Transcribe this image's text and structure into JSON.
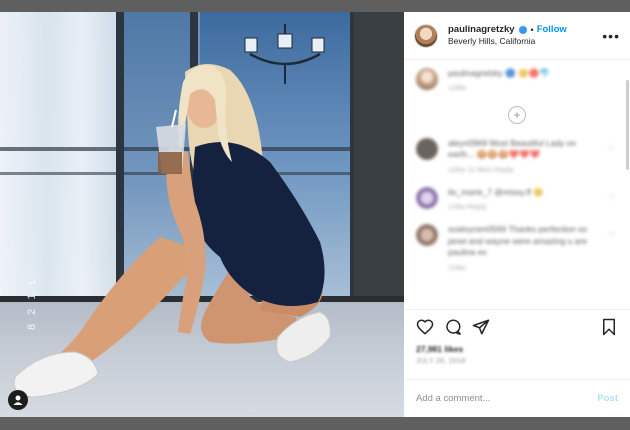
{
  "post": {
    "image_alt": "Woman with long blonde hair in a navy t-shirt and shorts crouching barefoot-style in white sneakers holding an iced drink on a balcony",
    "story_tag": "8 2 1 L"
  },
  "header": {
    "username": "paulinagretzky",
    "follow_label": "Follow",
    "dot": "•",
    "location": "Beverly Hills, California",
    "more_icon": "•••"
  },
  "comments": [
    {
      "user": "paulinagretzky",
      "text": "paulinagretzky 🔵 😊🔴🐬",
      "meta": "128w"
    },
    {
      "user": "aleyn0969",
      "text": "aleyn0969 Most Beautiful Lady on earth... 🍪🍪🍪❤️❤️❤️",
      "meta": "118w   11 likes   Reply"
    },
    {
      "user": "its_marie_7",
      "text": "its_marie_7 @missy.ff 😊",
      "meta": "118w   Reply"
    },
    {
      "user": "soaloyram0569",
      "text": "soaloyram0569 Thanks perfection so janet and wayne were amazing u are paulina ex",
      "meta": "118w"
    }
  ],
  "load_more_icon": "+",
  "actions": {
    "like_icon": "heart-icon",
    "comment_icon": "comment-icon",
    "share_icon": "share-icon",
    "save_icon": "bookmark-icon",
    "likes": "27,981 likes",
    "date": "JULY 26, 2018"
  },
  "add_comment": {
    "placeholder": "Add a comment...",
    "post_label": "Post"
  },
  "colors": {
    "accent": "#0095f6",
    "post_disabled": "#b2dffc",
    "backdrop": "#5f5f5f"
  }
}
